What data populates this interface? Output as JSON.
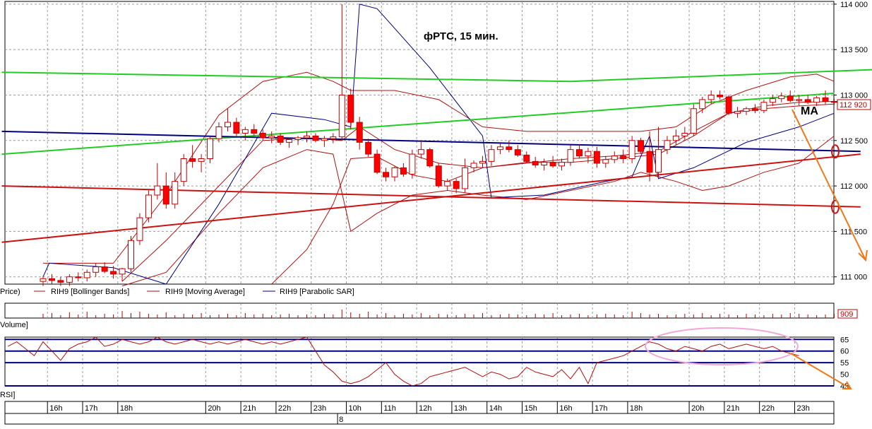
{
  "chart_data": {
    "type": "candlestick",
    "title": "фРТС,  15 мин.",
    "annotation": "MA",
    "last_price_label": "112 920",
    "volume_last_label": "909",
    "price_axis": {
      "ylim": [
        110920,
        114030
      ],
      "ticks": [
        111000,
        111500,
        112000,
        112500,
        113000,
        113500,
        114000
      ],
      "tick_labels": [
        "111 000",
        "111 500",
        "112 000",
        "112 500",
        "113 000",
        "113 500",
        "114 000"
      ]
    },
    "rsi_axis": {
      "ylim": [
        45,
        66
      ],
      "ticks": [
        45,
        50,
        55,
        60,
        65
      ],
      "tick_labels": [
        "45",
        "50",
        "55",
        "60",
        "65"
      ],
      "levels": [
        65,
        60,
        55,
        45
      ]
    },
    "legend": {
      "price": "Price)",
      "bollinger": "RIH9 [Bollinger Bands]",
      "ma": "RIH9 [Moving Average]",
      "psar": "RIH9 [Parabolic SAR]",
      "volume": "Volume]",
      "rsi": "RSI]"
    },
    "time_axis": {
      "labels": [
        "16h",
        "17h",
        "18h",
        "20h",
        "21h",
        "22h",
        "23h",
        "10h",
        "11h",
        "12h",
        "13h",
        "14h",
        "15h",
        "16h",
        "17h",
        "18h",
        "20h",
        "21h",
        "22h",
        "23h"
      ],
      "label_bars": [
        1,
        5,
        9,
        19,
        23,
        27,
        31,
        35,
        39,
        43,
        47,
        51,
        55,
        59,
        63,
        67,
        74,
        78,
        82,
        86
      ],
      "day_label": "8",
      "day_bar": 34
    },
    "candles": [
      [
        110950,
        111010,
        110900,
        110980
      ],
      [
        110980,
        111030,
        110920,
        110960
      ],
      [
        110960,
        111000,
        110900,
        110940
      ],
      [
        110940,
        111030,
        110900,
        111000
      ],
      [
        111000,
        111050,
        110950,
        110990
      ],
      [
        110990,
        111080,
        110950,
        111050
      ],
      [
        111050,
        111150,
        111000,
        111110
      ],
      [
        111110,
        111160,
        111040,
        111060
      ],
      [
        111060,
        111120,
        110980,
        111030
      ],
      [
        111030,
        111100,
        110950,
        111090
      ],
      [
        111090,
        111450,
        111050,
        111400
      ],
      [
        111400,
        111700,
        111350,
        111650
      ],
      [
        111650,
        111950,
        111600,
        111900
      ],
      [
        111900,
        112250,
        111850,
        112000
      ],
      [
        112000,
        112150,
        111750,
        111800
      ],
      [
        111800,
        112150,
        111750,
        112050
      ],
      [
        112050,
        112350,
        112000,
        112300
      ],
      [
        112300,
        112450,
        112200,
        112270
      ],
      [
        112270,
        112350,
        112150,
        112300
      ],
      [
        112300,
        112550,
        112250,
        112520
      ],
      [
        112520,
        112700,
        112480,
        112650
      ],
      [
        112650,
        112850,
        112600,
        112700
      ],
      [
        112700,
        112750,
        112550,
        112580
      ],
      [
        112580,
        112650,
        112500,
        112620
      ],
      [
        112620,
        112680,
        112550,
        112580
      ],
      [
        112580,
        112620,
        112500,
        112530
      ],
      [
        112530,
        112600,
        112470,
        112550
      ],
      [
        112550,
        112580,
        112450,
        112480
      ],
      [
        112480,
        112530,
        112420,
        112510
      ],
      [
        112510,
        112550,
        112450,
        112530
      ],
      [
        112530,
        112600,
        112480,
        112550
      ],
      [
        112550,
        112580,
        112480,
        112500
      ],
      [
        112500,
        112550,
        112430,
        112520
      ],
      [
        112520,
        112580,
        112470,
        112540
      ],
      [
        112540,
        114000,
        112500,
        113000
      ],
      [
        113000,
        113070,
        112620,
        112700
      ],
      [
        112700,
        112760,
        112400,
        112480
      ],
      [
        112480,
        112520,
        112320,
        112350
      ],
      [
        112350,
        112400,
        112130,
        112150
      ],
      [
        112150,
        112200,
        112050,
        112100
      ],
      [
        112100,
        112220,
        112050,
        112200
      ],
      [
        112200,
        112250,
        112100,
        112130
      ],
      [
        112130,
        112400,
        112080,
        112350
      ],
      [
        112350,
        112500,
        112300,
        112400
      ],
      [
        112400,
        112420,
        112200,
        112220
      ],
      [
        112220,
        112250,
        111980,
        112000
      ],
      [
        112000,
        112080,
        111950,
        112050
      ],
      [
        112050,
        112080,
        111920,
        111970
      ],
      [
        111970,
        112300,
        111930,
        112200
      ],
      [
        112200,
        112280,
        112150,
        112250
      ],
      [
        112250,
        112330,
        112200,
        112270
      ],
      [
        112270,
        112450,
        112220,
        112400
      ],
      [
        112400,
        112470,
        112350,
        112430
      ],
      [
        112430,
        112500,
        112370,
        112400
      ],
      [
        112400,
        112450,
        112320,
        112340
      ],
      [
        112340,
        112380,
        112250,
        112270
      ],
      [
        112270,
        112320,
        112200,
        112230
      ],
      [
        112230,
        112300,
        112170,
        112260
      ],
      [
        112260,
        112330,
        112200,
        112220
      ],
      [
        112220,
        112300,
        112170,
        112260
      ],
      [
        112260,
        112450,
        112220,
        112400
      ],
      [
        112400,
        112460,
        112300,
        112330
      ],
      [
        112330,
        112420,
        112250,
        112380
      ],
      [
        112380,
        112430,
        112200,
        112250
      ],
      [
        112250,
        112330,
        112200,
        112290
      ],
      [
        112290,
        112380,
        112250,
        112330
      ],
      [
        112330,
        112400,
        112250,
        112300
      ],
      [
        112300,
        112550,
        112250,
        112500
      ],
      [
        112500,
        112530,
        112350,
        112380
      ],
      [
        112380,
        112600,
        112050,
        112150
      ],
      [
        112150,
        112650,
        112100,
        112400
      ],
      [
        112400,
        112550,
        112350,
        112500
      ],
      [
        112500,
        112620,
        112450,
        112550
      ],
      [
        112550,
        112650,
        112500,
        112580
      ],
      [
        112580,
        112900,
        112550,
        112850
      ],
      [
        112850,
        112980,
        112800,
        112950
      ],
      [
        112950,
        113050,
        112900,
        113000
      ],
      [
        113000,
        113050,
        112950,
        112980
      ],
      [
        112980,
        113000,
        112780,
        112800
      ],
      [
        112800,
        112870,
        112750,
        112820
      ],
      [
        112820,
        112870,
        112780,
        112850
      ],
      [
        112850,
        112900,
        112800,
        112830
      ],
      [
        112830,
        112950,
        112800,
        112920
      ],
      [
        112920,
        113000,
        112880,
        112960
      ],
      [
        112960,
        113030,
        112920,
        112990
      ],
      [
        112990,
        113050,
        112920,
        112940
      ],
      [
        112940,
        113000,
        112880,
        112950
      ],
      [
        112950,
        113000,
        112900,
        112920
      ],
      [
        112920,
        112990,
        112880,
        112970
      ],
      [
        112970,
        113050,
        112900,
        112930
      ],
      [
        112930,
        112960,
        112890,
        112920
      ]
    ],
    "indicators": {
      "bb_upper": [
        [
          0,
          111150
        ],
        [
          8,
          111150
        ],
        [
          14,
          111900
        ],
        [
          20,
          112780
        ],
        [
          25,
          113150
        ],
        [
          30,
          113250
        ],
        [
          33,
          113150
        ],
        [
          35,
          113050
        ],
        [
          40,
          113050
        ],
        [
          45,
          112950
        ],
        [
          50,
          112650
        ],
        [
          55,
          112600
        ],
        [
          60,
          112600
        ],
        [
          65,
          112600
        ],
        [
          68,
          112600
        ],
        [
          72,
          112650
        ],
        [
          76,
          112900
        ],
        [
          80,
          113050
        ],
        [
          85,
          113200
        ],
        [
          88,
          113230
        ],
        [
          90,
          113150
        ]
      ],
      "bb_lower": [
        [
          9,
          110900
        ],
        [
          14,
          111050
        ],
        [
          20,
          111700
        ],
        [
          25,
          112200
        ],
        [
          30,
          112400
        ],
        [
          33,
          112350
        ],
        [
          35,
          111500
        ],
        [
          38,
          111700
        ],
        [
          42,
          111900
        ],
        [
          46,
          111950
        ],
        [
          50,
          111900
        ],
        [
          55,
          111850
        ],
        [
          60,
          111950
        ],
        [
          65,
          112050
        ],
        [
          68,
          112150
        ],
        [
          72,
          112050
        ],
        [
          75,
          111950
        ],
        [
          78,
          112000
        ],
        [
          82,
          112150
        ],
        [
          86,
          112250
        ],
        [
          90,
          112550
        ]
      ],
      "bb_mid": [
        [
          9,
          110950
        ],
        [
          14,
          111400
        ],
        [
          20,
          112000
        ],
        [
          25,
          112500
        ],
        [
          30,
          112530
        ],
        [
          34,
          112500
        ],
        [
          36,
          112650
        ],
        [
          40,
          112400
        ],
        [
          45,
          112250
        ],
        [
          50,
          112200
        ],
        [
          55,
          112250
        ],
        [
          60,
          112300
        ],
        [
          65,
          112330
        ],
        [
          70,
          112380
        ],
        [
          74,
          112600
        ],
        [
          78,
          112800
        ],
        [
          82,
          112880
        ],
        [
          86,
          112920
        ],
        [
          90,
          112930
        ]
      ],
      "ma_long": [
        [
          0,
          112000
        ],
        [
          90,
          111800
        ]
      ],
      "ma_fast": [
        [
          26,
          110920
        ],
        [
          30,
          111300
        ],
        [
          33,
          111800
        ],
        [
          35,
          112300
        ],
        [
          38,
          112320
        ],
        [
          42,
          112120
        ],
        [
          46,
          112050
        ],
        [
          50,
          112200
        ],
        [
          55,
          112260
        ],
        [
          60,
          112260
        ],
        [
          65,
          112300
        ],
        [
          70,
          112350
        ],
        [
          74,
          112550
        ],
        [
          78,
          112800
        ],
        [
          82,
          112850
        ],
        [
          86,
          112880
        ],
        [
          90,
          112900
        ]
      ],
      "psar": [
        [
          0,
          111000
        ],
        [
          0.7,
          111150
        ],
        [
          8,
          111100
        ],
        [
          14,
          110920
        ],
        [
          20,
          111800
        ],
        [
          26,
          112800
        ],
        [
          32,
          112730
        ],
        [
          35,
          112650
        ],
        [
          36,
          114000
        ],
        [
          38,
          113950
        ],
        [
          44,
          113300
        ],
        [
          50,
          112550
        ],
        [
          51,
          111870
        ],
        [
          57,
          111900
        ],
        [
          64,
          112050
        ],
        [
          67,
          112100
        ],
        [
          69,
          112550
        ],
        [
          70,
          112080
        ],
        [
          74,
          112200
        ],
        [
          80,
          112480
        ],
        [
          86,
          112650
        ],
        [
          90,
          112800
        ]
      ]
    },
    "trendlines": {
      "green_rising": [
        [
          -4.7,
          112350
        ],
        [
          90,
          113020
        ]
      ],
      "green_falling": [
        [
          -4.7,
          113250
        ],
        [
          60,
          113030
        ],
        [
          94.5,
          113020
        ]
      ],
      "blue": [
        [
          -4.7,
          112600
        ],
        [
          93,
          112380
        ]
      ],
      "red_rising": [
        [
          -4.7,
          111380
        ],
        [
          93,
          112350
        ]
      ],
      "red_flat": [
        [
          -4.7,
          112000
        ],
        [
          93,
          111770
        ]
      ],
      "green_upper": [
        [
          -4.7,
          113250
        ],
        [
          60,
          113150
        ],
        [
          94.5,
          113280
        ]
      ],
      "projection": [
        [
          93,
          112810
        ],
        [
          101,
          111120
        ]
      ]
    },
    "rsi": [
      62,
      64,
      61,
      58,
      64,
      60,
      56,
      61,
      63,
      64,
      66,
      62,
      63,
      65,
      64,
      63,
      64,
      66,
      64,
      63,
      64,
      65,
      64,
      63,
      64,
      63,
      64,
      65,
      64,
      63,
      64,
      63,
      64,
      65,
      66,
      60,
      54,
      51,
      47,
      46,
      47,
      49,
      52,
      55,
      50,
      47,
      45,
      46,
      49,
      50,
      51,
      52,
      53,
      51,
      49,
      51,
      50,
      48,
      49,
      53,
      51,
      50,
      49,
      52,
      48,
      53,
      46,
      55,
      56,
      57,
      58,
      60,
      62,
      64,
      63,
      61,
      60,
      62,
      61,
      60,
      62,
      63,
      61,
      62,
      63,
      62,
      61,
      62,
      60,
      59,
      58
    ],
    "volume": [
      6,
      7,
      4,
      8,
      5,
      9,
      4,
      6,
      5,
      10,
      7,
      9,
      6,
      5,
      8,
      4,
      6,
      5,
      7,
      4,
      5,
      6,
      4,
      7,
      5,
      6,
      4,
      5,
      6,
      4,
      5,
      4,
      6,
      5,
      12,
      8,
      6,
      9,
      5,
      7,
      4,
      6,
      5,
      7,
      4,
      6,
      5,
      4,
      6,
      5,
      7,
      4,
      5,
      6,
      5,
      4,
      6,
      5,
      7,
      4,
      5,
      6,
      4,
      5,
      6,
      5,
      4,
      9,
      7,
      5,
      6,
      4,
      5,
      6,
      5,
      7,
      4,
      6,
      5,
      4,
      6,
      5,
      4,
      6,
      5,
      7,
      6,
      5,
      4,
      5,
      6
    ]
  }
}
